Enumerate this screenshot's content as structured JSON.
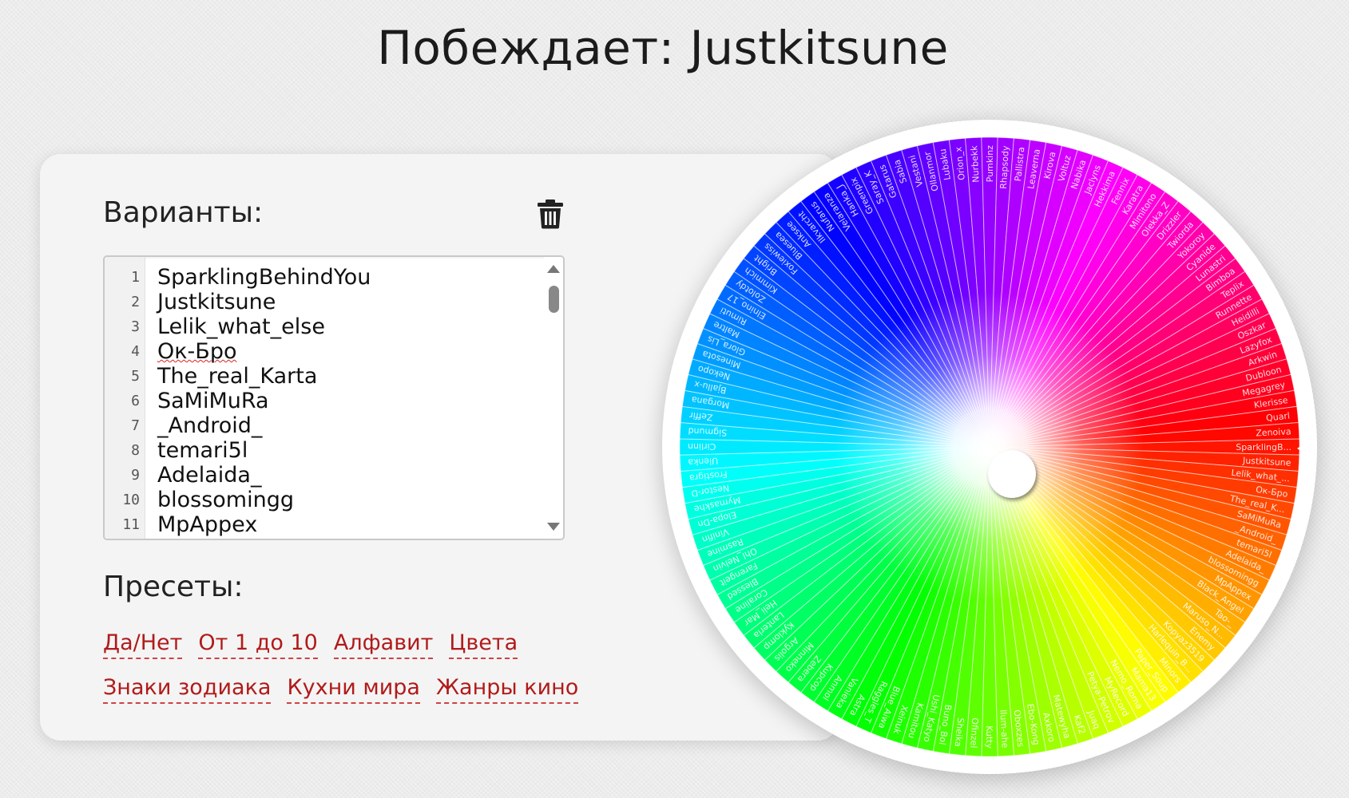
{
  "header": {
    "winner_text": "Побеждает: Justkitsune"
  },
  "editor": {
    "label": "Варианты:",
    "lines": [
      {
        "num": "1",
        "text": "SparklingBehindYou"
      },
      {
        "num": "2",
        "text": "Justkitsune"
      },
      {
        "num": "3",
        "text": "Lelik_what_else"
      },
      {
        "num": "4",
        "text": "Ок-Бро"
      },
      {
        "num": "5",
        "text": "The_real_Karta"
      },
      {
        "num": "6",
        "text": "SaMiMuRa"
      },
      {
        "num": "7",
        "text": "_Android_"
      },
      {
        "num": "8",
        "text": "temari5l"
      },
      {
        "num": "9",
        "text": "Adelaida_"
      },
      {
        "num": "10",
        "text": "blossomingg"
      },
      {
        "num": "11",
        "text": "MpAppex"
      }
    ]
  },
  "presets": {
    "label": "Пресеты:",
    "row1": [
      "Да/Нет",
      "От 1 до 10",
      "Алфавит",
      "Цвета"
    ],
    "row2": [
      "Знаки зодиака",
      "Кухни мира",
      "Жанры кино"
    ]
  },
  "wheel": {
    "segment_count": 120,
    "slice_labels": [
      "SparklingB...",
      "Justkitsune",
      "Lelik_what_...",
      "Ок-Бро",
      "The_real_K...",
      "SaMiMuRa",
      "_Android_",
      "temari5l",
      "Adelaida_",
      "blossomingg",
      "MpAppex",
      "Black_Angel",
      "Tao-_",
      "Maruso_N...",
      "Enemy",
      "Kopyaz3519",
      "Harlequin_B...",
      "Minors",
      "Paper_Soup",
      "Mama13",
      "Nemo_Roma",
      "MyRecord",
      "Petya-Petrov",
      "Juaq",
      "Kaf2",
      "Matewyha",
      "Axkoro",
      "Ebo-Kong",
      "Oboxzes",
      "Ilum-ahe",
      "Kutty",
      "Ofinzel",
      "Sheika",
      "Buno_Bol",
      "Ushi_Katyo",
      "Kamitou",
      "Xeinuk",
      "Blue_Aiwa",
      "Raggles_T",
      "Astra",
      "Vanieka",
      "Anmol",
      "Kupcop",
      "Zebera",
      "Minneko",
      "Argolis",
      "Kyklomp",
      "Lanterla",
      "Heli_Mar",
      "Coraline",
      "Blessed",
      "Farengeit",
      "Ohl_Nelvin",
      "Rasmine",
      "Vinifin",
      "Elopa-Dn",
      "Mymaskhe",
      "Nestor-D",
      "Frostigra",
      "Ulenka",
      "Cirlinn",
      "Sigmund",
      "Zeffir",
      "Morgana",
      "Bjallu-x",
      "Nekopo",
      "Minesota",
      "Glora_Lis",
      "Maltre",
      "Rimuti",
      "Elnino_17",
      "Zolotdy",
      "Kimmich",
      "Bright",
      "Foxiewiss",
      "Bluesea",
      "Anksee",
      "Ilkvarcht",
      "Nufarus",
      "Velaranza",
      "Hanka_J",
      "Greenpix",
      "Saray_K",
      "Gatarus",
      "Sabia",
      "Vestani",
      "Ollanmor",
      "Lubaku",
      "Orion_x",
      "Nurbekk",
      "Pumkinz",
      "Rhapsody",
      "Pallistra",
      "Leaverna",
      "Kirova",
      "Voltuz",
      "Nabika",
      "Jaclyns",
      "Hekkima",
      "Fennix",
      "Karatra",
      "Mimitono",
      "Olekka_Z",
      "Drizzler",
      "Twiorda",
      "Yokoroy",
      "Cyanide",
      "Lunastri",
      "Bimboa",
      "Teplix",
      "Runnette",
      "Heidilli",
      "Oszkar",
      "Lazyfox",
      "Arkwin",
      "Dubloon",
      "Megagrey",
      "Klerisse",
      "Quarl",
      "Zenoiva"
    ]
  }
}
